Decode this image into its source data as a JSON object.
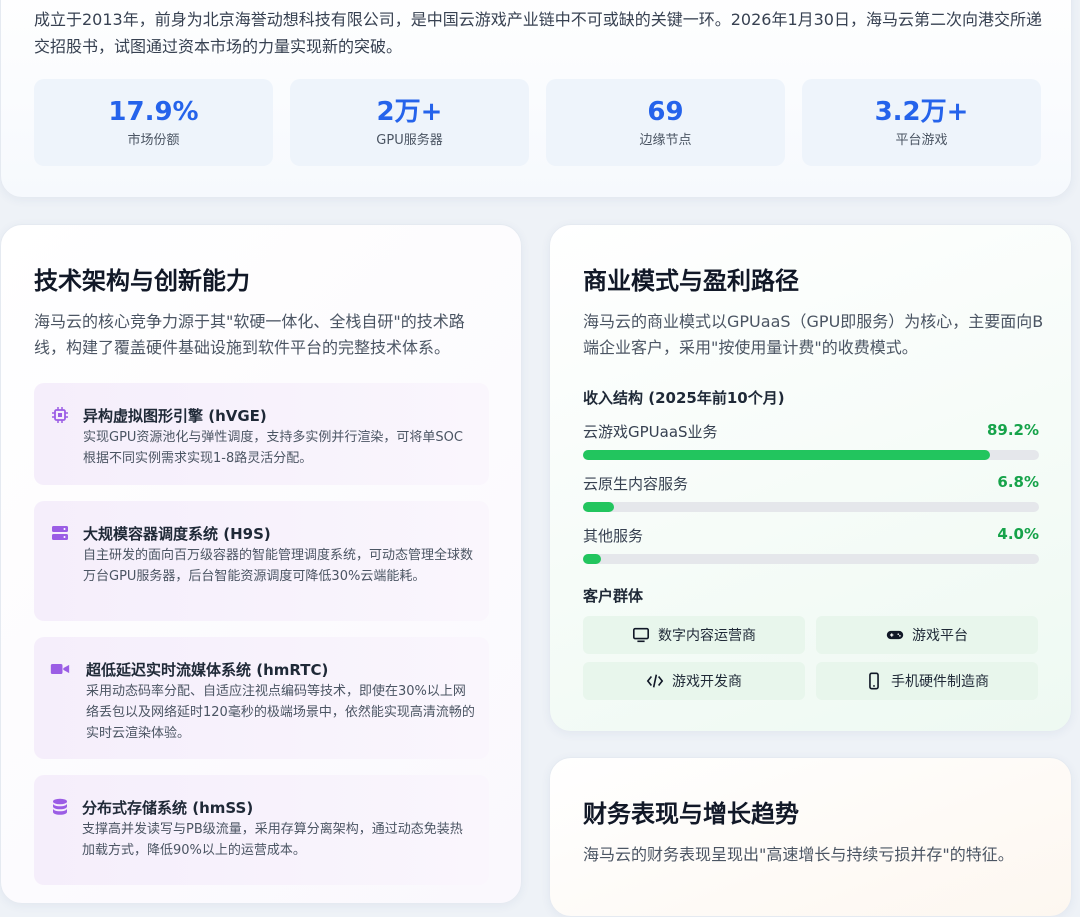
{
  "intro": {
    "text": "成立于2013年，前身为北京海誉动想科技有限公司，是中国云游戏产业链中不可或缺的关键一环。2026年1月30日，海马云第二次向港交所递交招股书，试图通过资本市场的力量实现新的突破。"
  },
  "stats": [
    {
      "value": "17.9%",
      "label": "市场份额"
    },
    {
      "value": "2万+",
      "label": "GPU服务器"
    },
    {
      "value": "69",
      "label": "边缘节点"
    },
    {
      "value": "3.2万+",
      "label": "平台游戏"
    }
  ],
  "tech": {
    "title": "技术架构与创新能力",
    "desc": "海马云的核心竞争力源于其\"软硬一体化、全栈自研\"的技术路线，构建了覆盖硬件基础设施到软件平台的完整技术体系。",
    "features": [
      {
        "icon": "chip-icon",
        "title": "异构虚拟图形引擎 (hVGE)",
        "desc": "实现GPU资源池化与弹性调度，支持多实例并行渲染，可将单SOC根据不同实例需求实现1-8路灵活分配。"
      },
      {
        "icon": "server-icon",
        "title": "大规模容器调度系统 (H9S)",
        "desc": "自主研发的面向百万级容器的智能管理调度系统，可动态管理全球数万台GPU服务器，后台智能资源调度可降低30%云端能耗。"
      },
      {
        "icon": "video-camera-icon",
        "title": "超低延迟实时流媒体系统 (hmRTC)",
        "desc": "采用动态码率分配、自适应注视点编码等技术，即使在30%以上网络丢包以及网络延时120毫秒的极端场景中，依然能实现高清流畅的实时云渲染体验。"
      },
      {
        "icon": "database-icon",
        "title": "分布式存储系统 (hmSS)",
        "desc": "支撑高并发读写与PB级流量，采用存算分离架构，通过动态免装热加载方式，降低90%以上的运营成本。"
      }
    ]
  },
  "business": {
    "title": "商业模式与盈利路径",
    "desc": "海马云的商业模式以GPUaaS（GPU即服务）为核心，主要面向B端企业客户，采用\"按使用量计费\"的收费模式。",
    "revenue_title": "收入结构 (2025年前10个月)",
    "revenue": [
      {
        "name": "云游戏GPUaaS业务",
        "value": "89.2%",
        "fraction": 0.892
      },
      {
        "name": "云原生内容服务",
        "value": "6.8%",
        "fraction": 0.068
      },
      {
        "name": "其他服务",
        "value": "4.0%",
        "fraction": 0.04
      }
    ],
    "customers_title": "客户群体",
    "customers": [
      {
        "icon": "monitor-icon",
        "label": "数字内容运营商"
      },
      {
        "icon": "gamepad-icon",
        "label": "游戏平台"
      },
      {
        "icon": "code-icon",
        "label": "游戏开发商"
      },
      {
        "icon": "smartphone-icon",
        "label": "手机硬件制造商"
      }
    ],
    "accent_color": "#22c55e"
  },
  "finance": {
    "title": "财务表现与增长趋势",
    "desc": "海马云的财务表现呈现出\"高速增长与持续亏损并存\"的特征。"
  },
  "colors": {
    "stat_value": "#2563eb",
    "feature_icon": "#9b5de5",
    "revenue_value": "#16a34a"
  }
}
